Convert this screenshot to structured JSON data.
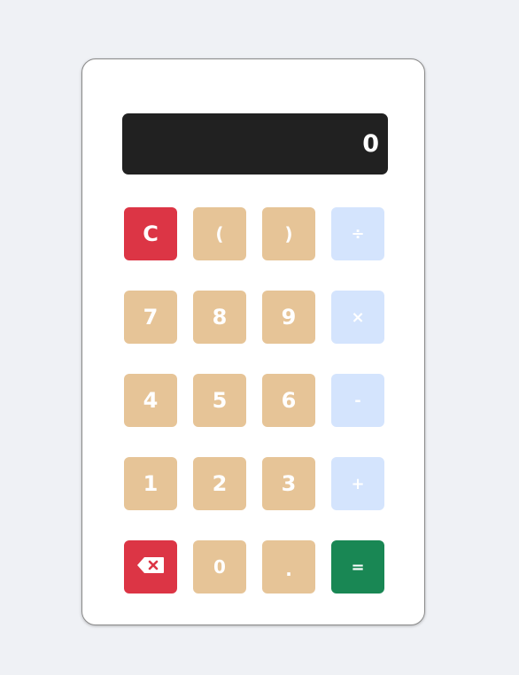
{
  "display": {
    "value": "0"
  },
  "keys": {
    "clear": "C",
    "open_paren": "(",
    "close_paren": ")",
    "divide": "÷",
    "seven": "7",
    "eight": "8",
    "nine": "9",
    "multiply": "×",
    "four": "4",
    "five": "5",
    "six": "6",
    "subtract": "-",
    "one": "1",
    "two": "2",
    "three": "3",
    "add": "+",
    "backspace_icon": "backspace-icon",
    "zero": "0",
    "decimal": ".",
    "equals": "="
  },
  "colors": {
    "background": "#eff1f5",
    "display": "#212121",
    "number_key": "#e6c497",
    "operator_key": "#d4e4fd",
    "danger_key": "#dc3545",
    "equals_key": "#198754"
  }
}
